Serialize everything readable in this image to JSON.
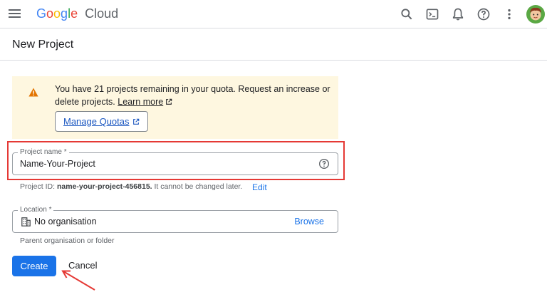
{
  "topbar": {
    "logo_google": "Google",
    "logo_cloud": "Cloud",
    "icons": [
      "menu-icon",
      "search-icon",
      "cloud-shell-icon",
      "notifications-icon",
      "help-icon",
      "more-vert-icon",
      "avatar"
    ]
  },
  "header": {
    "title": "New Project"
  },
  "banner": {
    "text": "You have 21 projects remaining in your quota. Request an increase or delete projects.",
    "learn_more": "Learn more",
    "manage_quotas": "Manage Quotas"
  },
  "project_name": {
    "label": "Project name *",
    "value": "Name-Your-Project",
    "hint_prefix": "Project ID:",
    "hint_id": "name-your-project-456815.",
    "hint_suffix": "It cannot be changed later.",
    "edit": "Edit"
  },
  "location": {
    "label": "Location *",
    "value": "No organisation",
    "browse": "Browse",
    "hint": "Parent organisation or folder"
  },
  "actions": {
    "create": "Create",
    "cancel": "Cancel"
  },
  "colors": {
    "primary": "#1a73e8",
    "banner_bg": "#fef7e0",
    "warning": "#e37400",
    "annotation_red": "#e53935"
  }
}
